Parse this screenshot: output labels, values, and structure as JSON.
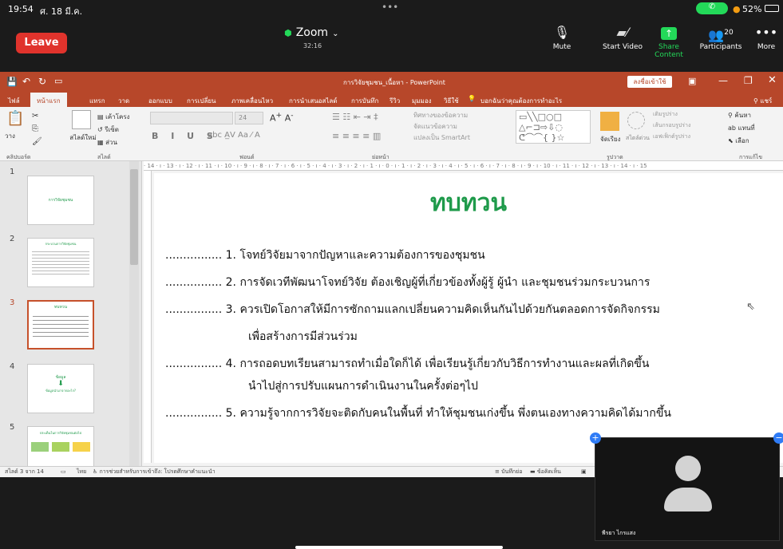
{
  "status": {
    "time": "19:54",
    "date": "ศ. 18 มี.ค.",
    "battery": "52%"
  },
  "zoom": {
    "leave_label": "Leave",
    "title": "Zoom",
    "timer": "32:16",
    "controls": [
      {
        "label": "Mute",
        "icon": "microphone-icon"
      },
      {
        "label": "Start Video",
        "icon": "video-off-icon"
      },
      {
        "label": "Share Content",
        "icon": "share-icon"
      },
      {
        "label": "Participants",
        "icon": "participants-icon",
        "count": "20"
      },
      {
        "label": "More",
        "icon": "more-icon"
      }
    ],
    "accent": "#23d959"
  },
  "ppt": {
    "window_title": "การวิจัยชุมชน_เนื้อหา - PowerPoint",
    "login": "ลงชื่อเข้าใช้",
    "tabs": [
      "ไฟล์",
      "หน้าแรก",
      "แทรก",
      "วาด",
      "ออกแบบ",
      "การเปลี่ยน",
      "ภาพเคลื่อนไหว",
      "การนำเสนอสไลด์",
      "การบันทึก",
      "รีวิว",
      "มุมมอง",
      "วิธีใช้"
    ],
    "search_hint": "บอกฉันว่าคุณต้องการทำอะไร",
    "share": "แชร์",
    "ribbon": {
      "paste": "วาง",
      "new_slide": "สไลด์ใหม่",
      "layout": "เค้าโครง",
      "reset": "รีเซ็ต",
      "section": "ส่วน",
      "font_size": "24",
      "find": "ค้นหา",
      "replace": "แทนที่",
      "select": "เลือก",
      "arrange": "จัดเรียง",
      "quick_styles": "สไตล์ด่วน",
      "text_direction": "ทิศทางของข้อความ",
      "align_text": "จัดแนวข้อความ",
      "smartart": "แปลงเป็น SmartArt",
      "shape_fill": "เติมรูปร่าง",
      "shape_outline": "เส้นกรอบรูปร่าง",
      "shape_effects": "เอฟเฟ็กต์รูปร่าง",
      "groups": [
        "คลิปบอร์ด",
        "สไลด์",
        "ฟอนต์",
        "ย่อหน้า",
        "รูปวาด",
        "การแก้ไข"
      ]
    },
    "thumbs": [
      "1",
      "2",
      "3",
      "4",
      "5"
    ],
    "thumb1_text": "การวิจัยชุมชน",
    "thumb2_title": "กระบวนการวิจัยชุมชน",
    "thumb3_title": "ทบทวน",
    "thumb4_title": "ข้อมูล",
    "thumb4_sub": "ข้อมูลนำมาจากอะไร?",
    "thumb5_title": "ประเด็นในการวิจัยชุมชนต่อไป",
    "ruler": "· 14 · ı · 13 · ı · 12 · ı · 11 · ı · 10 · ı · 9 · ı · 8 · ı · 7 · ı · 6 · ı · 5 · ı · 4 · ı · 3 · ı · 2 · ı · 1 · ı · 0 · ı · 1 · ı · 2 · ı · 3 · ı · 4 · ı · 5 · ı · 6 · ı · 7 · ı · 8 · ı · 9 · ı · 10 · ı · 11 · ı · 12 · ı · 13 · ı · 14 · ı · 15",
    "slide": {
      "title": "ทบทวน",
      "lines": [
        "................ 1.  โจทย์วิจัยมาจากปัญหาและความต้องการของชุมชน",
        "................ 2.  การจัดเวทีพัฒนาโจทย์วิจัย ต้องเชิญผู้ที่เกี่ยวข้องทั้งผู้รู้ ผู้นำ และชุมชนร่วมกระบวนการ",
        "................ 3.  ควรเปิดโอกาสให้มีการซักถามแลกเปลี่ยนความคิดเห็นกันไปด้วยกันตลอดการจัดกิจกรรม",
        "เพื่อสร้างการมีส่วนร่วม",
        "................ 4.  การถอดบทเรียนสามารถทำเมื่อใดก็ได้ เพื่อเรียนรู้เกี่ยวกับวิธีการทำงานและผลที่เกิดขึ้น",
        "นำไปสู่การปรับแผนการดำเนินงานในครั้งต่อๆไป",
        "................ 5.  ความรู้จากการวิจัยจะติดกับคนในพื้นที่ ทำให้ชุมชนเก่งขึ้น พึ่งตนเองทางความคิดได้มากขึ้น"
      ]
    },
    "status_slide": "สไลด์ 3 จาก 14",
    "status_lang": "ไทย",
    "status_access": "การช่วยสำหรับการเข้าถึง: โปรดศึกษาคำแนะนำ",
    "notes": "บันทึกย่อ",
    "comments": "ข้อคิดเห็น"
  },
  "participant": {
    "name": "พีรยา ไกรแสง"
  }
}
